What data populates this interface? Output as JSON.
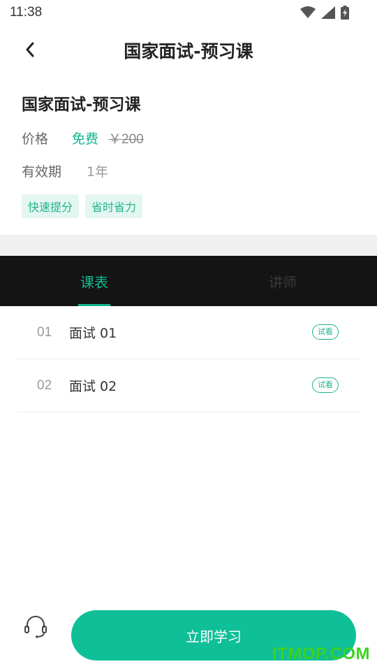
{
  "status_bar": {
    "time": "11:38"
  },
  "nav": {
    "title": "国家面试-预习课"
  },
  "course": {
    "title": "国家面试-预习课",
    "price_label": "价格",
    "price_free": "免费",
    "price_original": "￥200",
    "validity_label": "有效期",
    "validity_value": "1年",
    "tags": [
      "快速提分",
      "省时省力"
    ]
  },
  "tabs": [
    {
      "label": "课表",
      "active": true
    },
    {
      "label": "讲师",
      "active": false
    }
  ],
  "lessons": [
    {
      "num": "01",
      "title": "面试 01",
      "badge": "试看"
    },
    {
      "num": "02",
      "title": "面试 02",
      "badge": "试看"
    }
  ],
  "bottom": {
    "study_label": "立即学习",
    "service_icon": "headset-icon"
  },
  "watermark": "ITMOP.COM",
  "colors": {
    "accent": "#0fbf98",
    "tab_bar_bg": "#141414",
    "tag_bg": "#e4f6f0"
  }
}
